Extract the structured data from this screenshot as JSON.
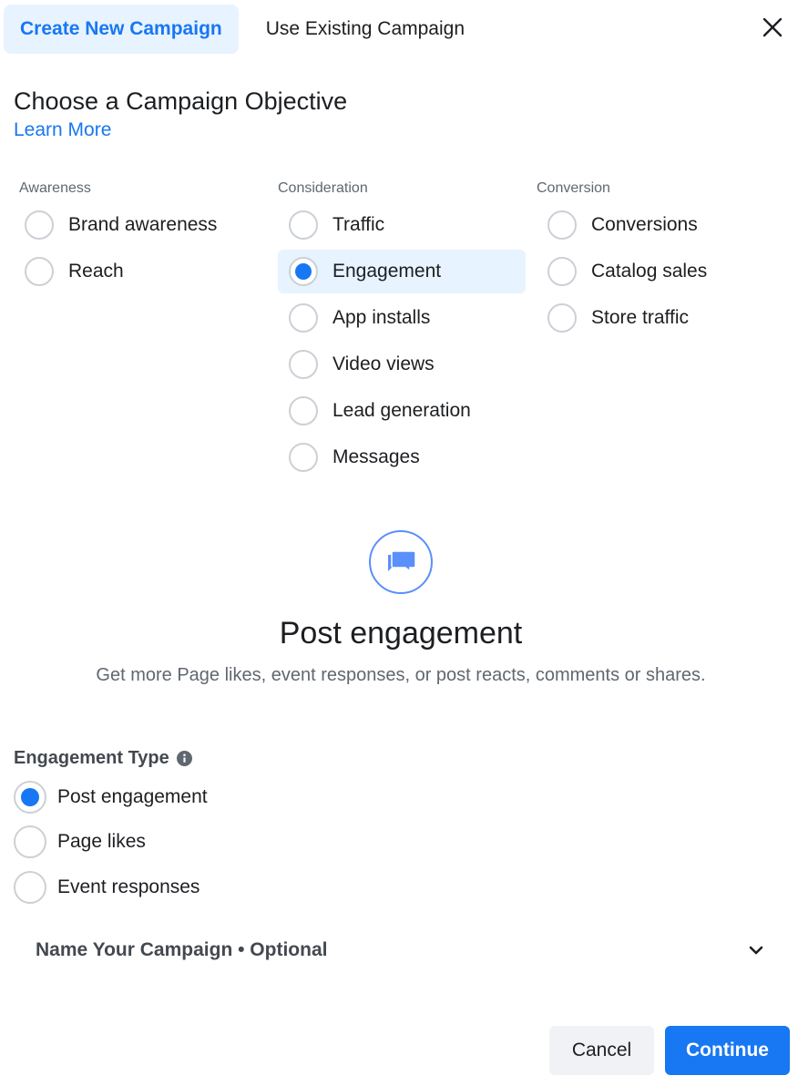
{
  "tabs": [
    {
      "label": "Create New Campaign",
      "active": true
    },
    {
      "label": "Use Existing Campaign",
      "active": false
    }
  ],
  "close_icon": "close-icon",
  "heading": "Choose a Campaign Objective",
  "learn_more": "Learn More",
  "objectives": {
    "awareness": {
      "label": "Awareness",
      "options": [
        "Brand awareness",
        "Reach"
      ]
    },
    "consideration": {
      "label": "Consideration",
      "options": [
        "Traffic",
        "Engagement",
        "App installs",
        "Video views",
        "Lead generation",
        "Messages"
      ]
    },
    "conversion": {
      "label": "Conversion",
      "options": [
        "Conversions",
        "Catalog sales",
        "Store traffic"
      ]
    },
    "selected": "Engagement"
  },
  "hero": {
    "icon": "chat-bubbles-icon",
    "title": "Post engagement",
    "description": "Get more Page likes, event responses, or post reacts, comments or shares."
  },
  "engagement_type": {
    "label": "Engagement Type",
    "info_icon": "info-icon",
    "options": [
      "Post engagement",
      "Page likes",
      "Event responses"
    ],
    "selected": "Post engagement"
  },
  "name_campaign": {
    "label": "Name Your Campaign • Optional",
    "icon": "chevron-down-icon"
  },
  "buttons": {
    "cancel": "Cancel",
    "continue": "Continue"
  },
  "colors": {
    "accent": "#1877f2",
    "selected_bg": "#e7f3ff"
  }
}
